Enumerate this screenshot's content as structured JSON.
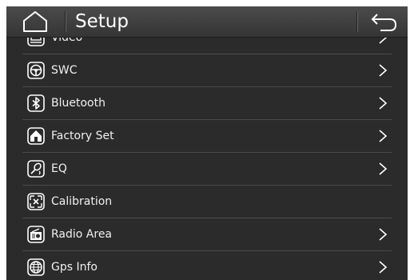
{
  "header": {
    "title": "Setup",
    "home_icon": "home-icon",
    "back_icon": "back-arrow-icon"
  },
  "menu": {
    "items": [
      {
        "label": "Video",
        "icon": "video-icon",
        "has_arrow": true
      },
      {
        "label": "SWC",
        "icon": "steering-wheel-icon",
        "has_arrow": true
      },
      {
        "label": "Bluetooth",
        "icon": "bluetooth-icon",
        "has_arrow": true
      },
      {
        "label": "Factory Set",
        "icon": "factory-house-icon",
        "has_arrow": true
      },
      {
        "label": "EQ",
        "icon": "equalizer-icon",
        "has_arrow": true
      },
      {
        "label": "Calibration",
        "icon": "calibration-icon",
        "has_arrow": false
      },
      {
        "label": "Radio Area",
        "icon": "radio-icon",
        "has_arrow": true
      },
      {
        "label": "Gps Info",
        "icon": "globe-icon",
        "has_arrow": true
      }
    ]
  },
  "colors": {
    "background": "#2b2b2b",
    "titlebar": "#404040",
    "divider": "#4a4a4a",
    "text": "#f0f0f0"
  }
}
